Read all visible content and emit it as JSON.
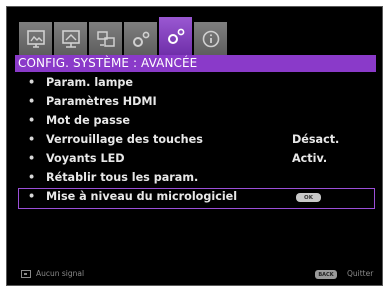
{
  "tabs": [
    {
      "icon": "image-icon",
      "active": false
    },
    {
      "icon": "screen-adjust-icon",
      "active": false
    },
    {
      "icon": "settings-display-icon",
      "active": false
    },
    {
      "icon": "system-config-icon",
      "active": false
    },
    {
      "icon": "advanced-config-icon",
      "active": true
    },
    {
      "icon": "info-icon",
      "active": false
    }
  ],
  "title": "CONFIG. SYSTÈME : AVANCÉE",
  "menu": {
    "items": [
      {
        "label": "Param. lampe",
        "value": ""
      },
      {
        "label": "Paramètres HDMI",
        "value": ""
      },
      {
        "label": "Mot de passe",
        "value": ""
      },
      {
        "label": "Verrouillage des touches",
        "value": "Désact."
      },
      {
        "label": "Voyants LED",
        "value": "Activ."
      },
      {
        "label": "Rétablir tous les param.",
        "value": ""
      },
      {
        "label": "Mise à niveau du micrologiciel",
        "value": "OK"
      }
    ],
    "bullet": "•"
  },
  "footer": {
    "signal": "Aucun signal",
    "back_button": "BACK",
    "quit": "Quitter"
  },
  "colors": {
    "accent": "#8a3ac9",
    "tab_inactive": "#6e6e6e",
    "background": "#000000",
    "text": "#e8e8e8"
  }
}
